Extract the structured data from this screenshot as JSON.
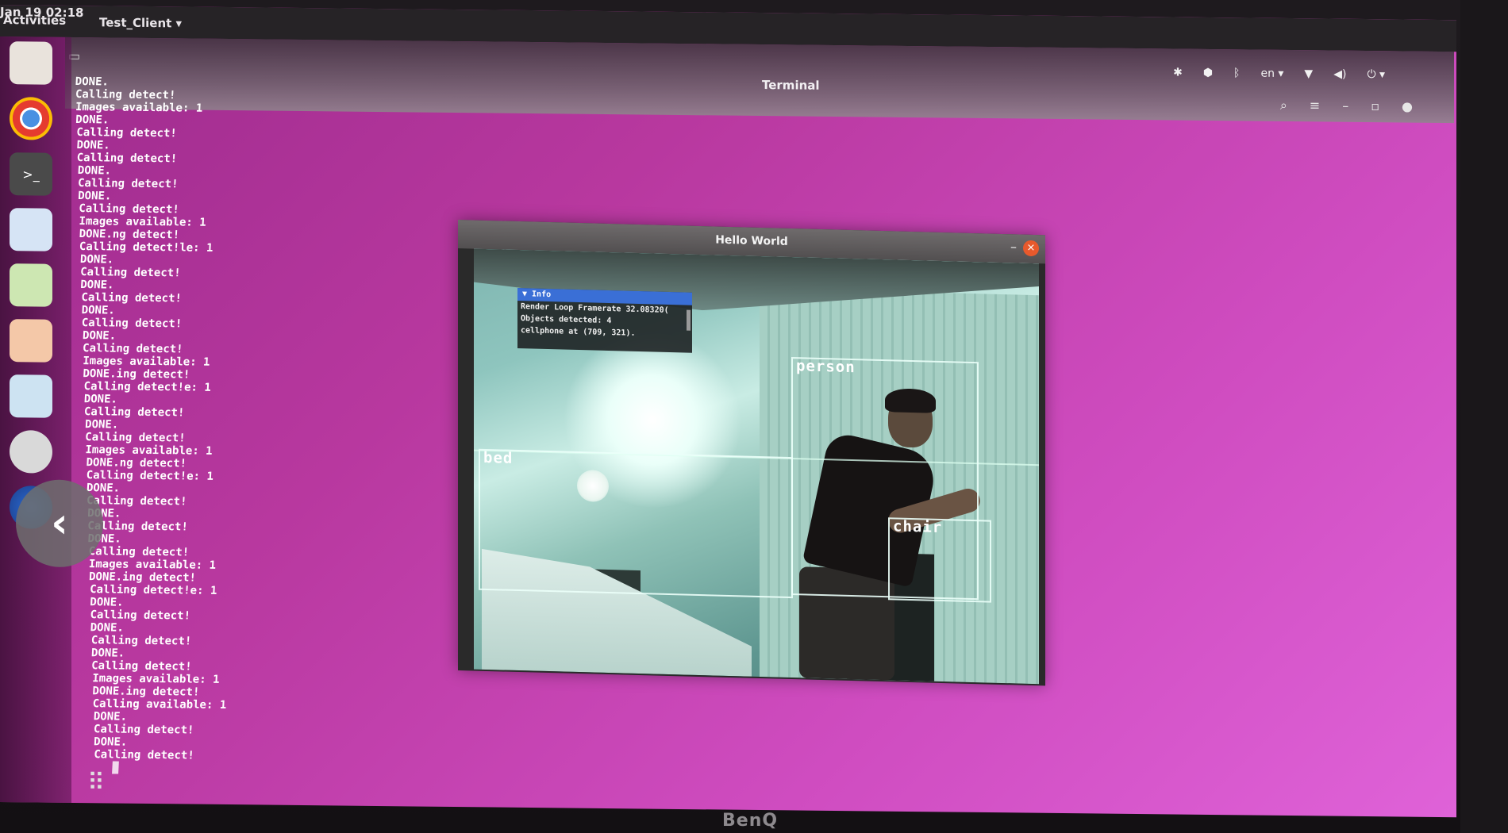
{
  "topbar": {
    "activities": "Activities",
    "app_menu": "Test_Client ▾",
    "clock": "Jan 19 02:18",
    "language": "en ▾"
  },
  "terminal": {
    "title": "Terminal",
    "lines": [
      "DONE.",
      "Calling detect!",
      "Images available: 1",
      "DONE.",
      "Calling detect!",
      "DONE.",
      "Calling detect!",
      "DONE.",
      "Calling detect!",
      "DONE.",
      "Calling detect!",
      "Images available: 1",
      "DONE.ng detect!",
      "Calling detect!le: 1",
      "DONE.",
      "Calling detect!",
      "DONE.",
      "Calling detect!",
      "DONE.",
      "Calling detect!",
      "DONE.",
      "Calling detect!",
      "Images available: 1",
      "DONE.ing detect!",
      "Calling detect!e: 1",
      "DONE.",
      "Calling detect!",
      "DONE.",
      "Calling detect!",
      "Images available: 1",
      "DONE.ng detect!",
      "Calling detect!e: 1",
      "DONE.",
      "Calling detect!",
      "DONE.",
      "Calling detect!",
      "DONE.",
      "Calling detect!",
      "Images available: 1",
      "DONE.ing detect!",
      "Calling detect!e: 1",
      "DONE.",
      "Calling detect!",
      "DONE.",
      "Calling detect!",
      "DONE.",
      "Calling detect!",
      "Images available: 1",
      "DONE.ing detect!",
      "Calling available: 1",
      "DONE.",
      "Calling detect!",
      "DONE.",
      "Calling detect!"
    ]
  },
  "hello_window": {
    "title": "Hello World",
    "info": {
      "header": "▼ Info",
      "rows": [
        "Render Loop Framerate 32.08320(",
        "Objects detected: 4",
        "cellphone at (709, 321)."
      ]
    },
    "detections": [
      {
        "label": "person"
      },
      {
        "label": "bed"
      },
      {
        "label": "chair"
      }
    ]
  },
  "dock": {
    "icons": [
      "files-icon",
      "chrome-icon",
      "terminal-icon",
      "text-editor-icon",
      "document-icon",
      "office-icon",
      "screenshot-icon",
      "settings-icon",
      "browser-icon",
      "show-apps-icon"
    ]
  },
  "monitor": {
    "brand": "BenQ"
  },
  "colors": {
    "desktop": "#c043b0",
    "topbar": "#262326",
    "info_header": "#3a6fd6",
    "close_button": "#e8592c"
  }
}
